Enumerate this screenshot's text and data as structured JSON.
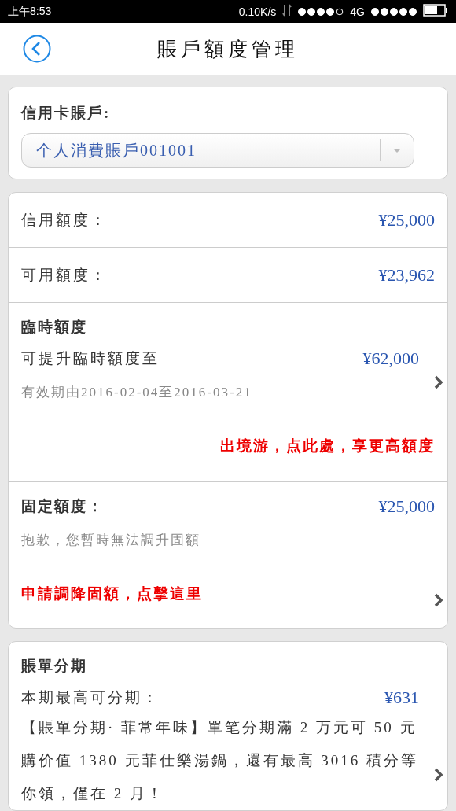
{
  "status_bar": {
    "time": "上午8:53",
    "speed": "0.10K/s",
    "network": "4G"
  },
  "header": {
    "title": "賬戶額度管理"
  },
  "account": {
    "label": "信用卡賬戶:",
    "value": "个人消費賬戶001001"
  },
  "limits": [
    {
      "label": "信用額度：",
      "amount": "¥25,000"
    },
    {
      "label": "可用額度：",
      "amount": "¥23,962"
    }
  ],
  "temporary": {
    "title": "臨時額度",
    "label": "可提升臨時額度至",
    "amount": "¥62,000",
    "validity": "有效期由2016-02-04至2016-03-21",
    "link": "出境游，点此處，享更高額度"
  },
  "fixed": {
    "title": "固定額度：",
    "amount": "¥25,000",
    "note": "抱歉，您暫時無法調升固額",
    "link": "申請調降固額，点擊這里"
  },
  "installment": {
    "title": "賬單分期",
    "label": "本期最高可分期：",
    "amount": "¥631",
    "promo": "【賬單分期· 菲常年味】單笔分期滿 2 万元可 50 元購价值 1380 元菲仕樂湯鍋，還有最高 3016 積分等你領，僅在 2 月！"
  }
}
